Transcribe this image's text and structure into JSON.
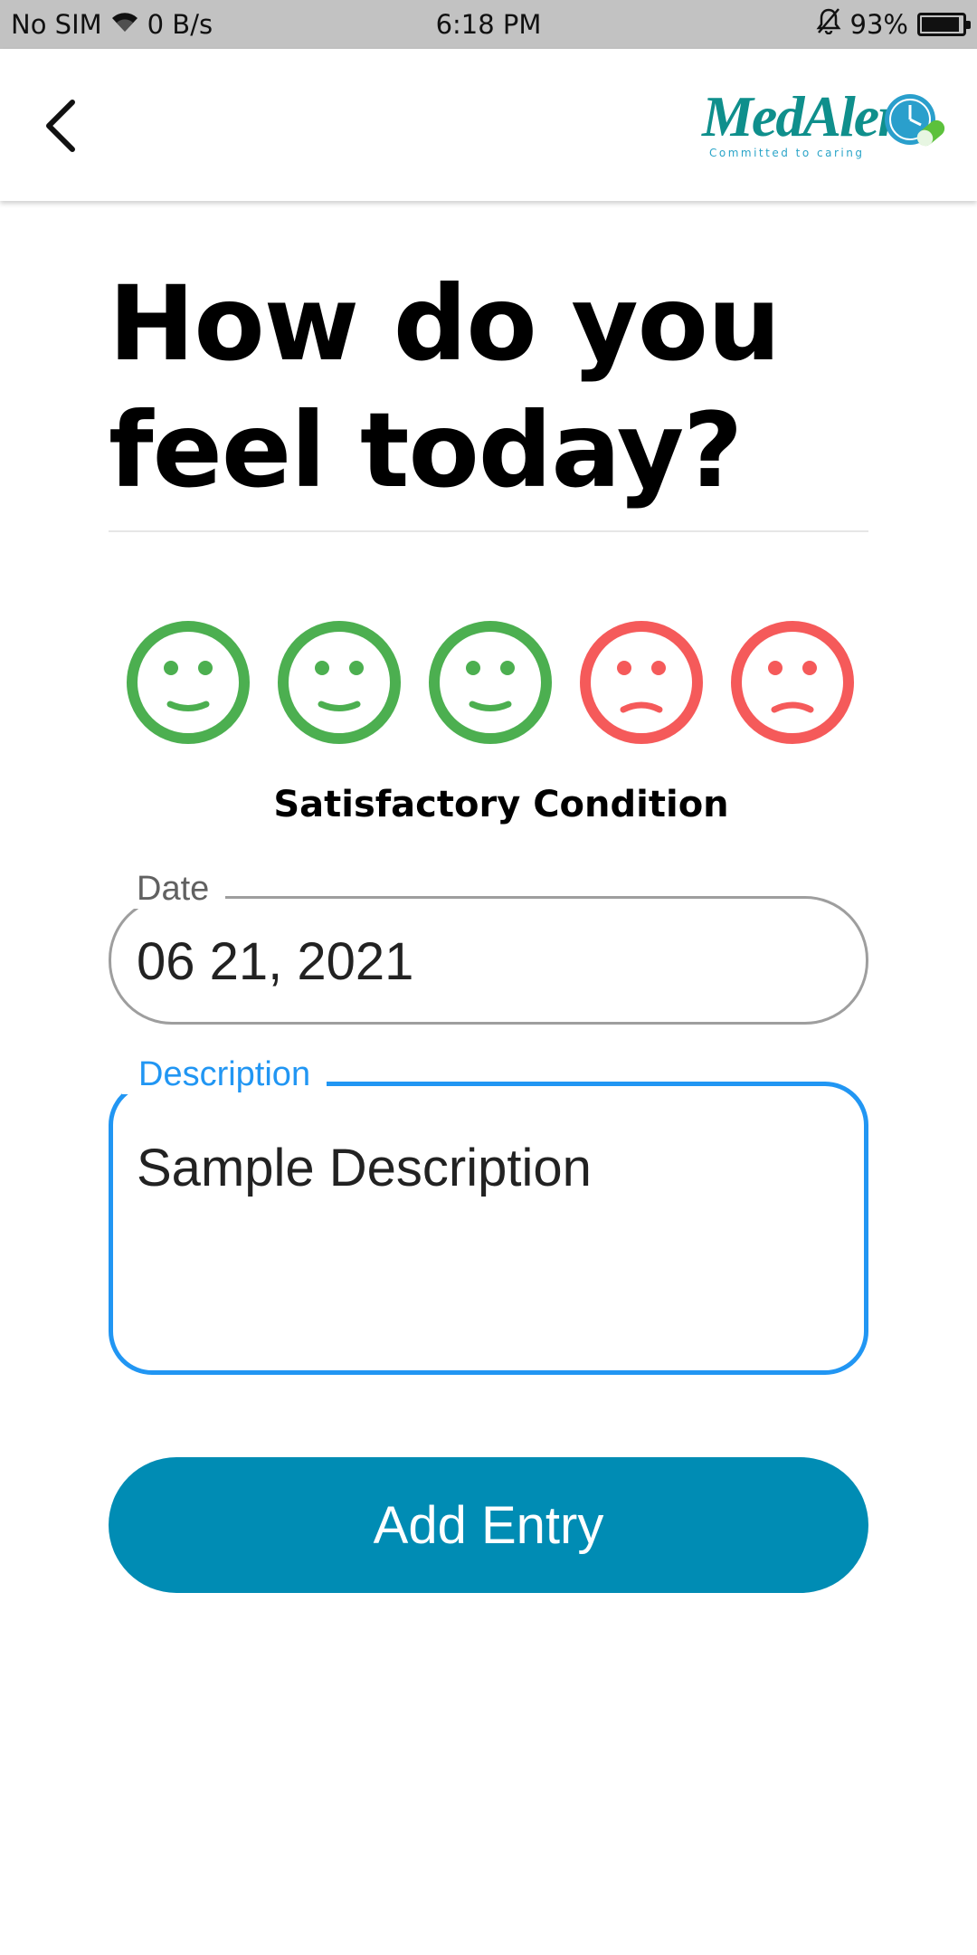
{
  "status_bar": {
    "carrier": "No SIM",
    "speed": "0 B/s",
    "time": "6:18 PM",
    "battery": "93%",
    "battery_level": 0.93
  },
  "header": {
    "back_icon": "chevron-left-icon",
    "logo_text": "MedAlert",
    "logo_tagline": "Committed to caring"
  },
  "heading": {
    "line1": "How do you",
    "line2": "feel today?"
  },
  "moods": [
    {
      "icon": "smiley-face-icon",
      "color": "#4caf50"
    },
    {
      "icon": "smiley-face-icon",
      "color": "#4caf50"
    },
    {
      "icon": "smiley-face-icon",
      "color": "#4caf50"
    },
    {
      "icon": "sad-face-icon",
      "color": "#f55a5a"
    },
    {
      "icon": "sad-face-icon",
      "color": "#f55a5a"
    }
  ],
  "mood_label": "Satisfactory Condition",
  "form": {
    "date_label": "Date",
    "date_value": "06 21, 2021",
    "description_label": "Description",
    "description_value": "Sample Description"
  },
  "actions": {
    "add_label": "Add Entry"
  },
  "colors": {
    "accent": "#008cb4",
    "focus": "#2196f3",
    "positive": "#4caf50",
    "negative": "#f55a5a"
  }
}
